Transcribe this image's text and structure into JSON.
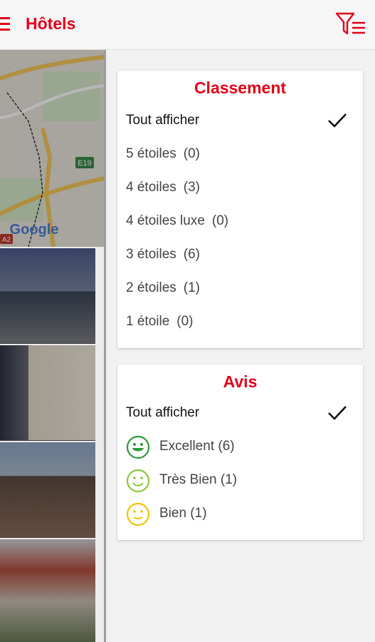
{
  "header": {
    "title": "Hôtels",
    "menu_icon": "hamburger-menu-icon",
    "filter_icon": "filter-list-icon",
    "accent_color": "#e2001a"
  },
  "map": {
    "road_label": "E19",
    "road_label_2": "A2",
    "logo_text": "Google"
  },
  "classement": {
    "title": "Classement",
    "items": [
      {
        "label": "Tout afficher",
        "count": "",
        "selected": true
      },
      {
        "label": "5 étoiles",
        "count": "(0)",
        "selected": false
      },
      {
        "label": "4 étoiles",
        "count": "(3)",
        "selected": false
      },
      {
        "label": "4 étoiles luxe",
        "count": "(0)",
        "selected": false
      },
      {
        "label": "3 étoiles",
        "count": "(6)",
        "selected": false
      },
      {
        "label": "2 étoiles",
        "count": "(1)",
        "selected": false
      },
      {
        "label": "1 étoile",
        "count": "(0)",
        "selected": false
      }
    ]
  },
  "avis": {
    "title": "Avis",
    "items": [
      {
        "label": "Tout afficher",
        "selected": true
      },
      {
        "label": "Excellent (6)",
        "icon": "smiley-excellent-icon",
        "color": "#2e9b3c"
      },
      {
        "label": "Très Bien (1)",
        "icon": "smiley-tres-bien-icon",
        "color": "#8cc63f"
      },
      {
        "label": "Bien (1)",
        "icon": "smiley-bien-icon",
        "color": "#f2c300"
      }
    ]
  }
}
